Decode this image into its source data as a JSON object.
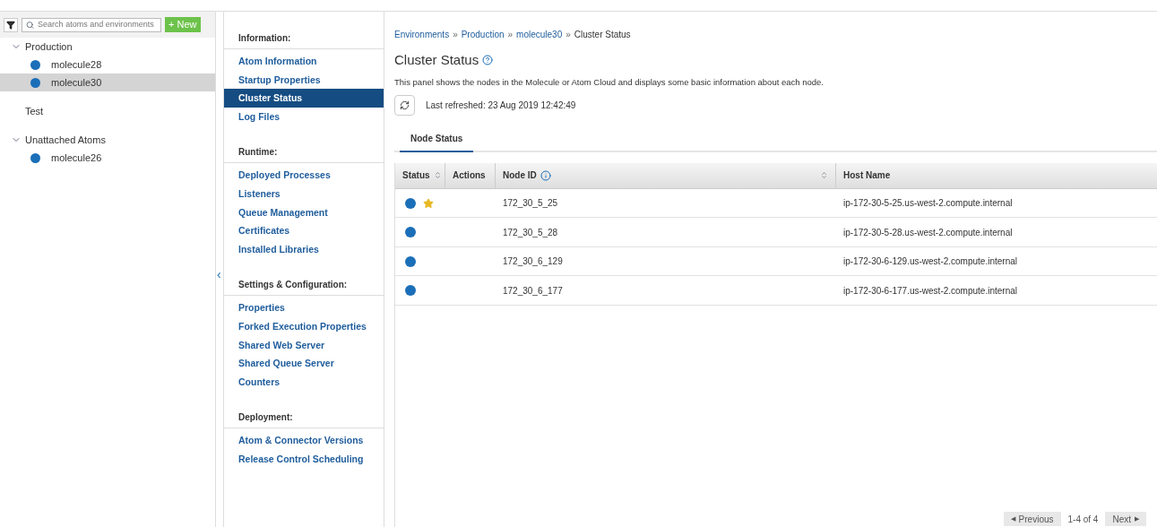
{
  "sidebar": {
    "search": {
      "placeholder": "Search atoms and environments"
    },
    "new_button": "+ New",
    "tree": [
      {
        "label": "Production",
        "expanded": true,
        "children": [
          {
            "label": "molecule28",
            "selected": false
          },
          {
            "label": "molecule30",
            "selected": true
          }
        ]
      },
      {
        "label": "Test"
      },
      {
        "label": "Unattached Atoms",
        "expanded": true,
        "children": [
          {
            "label": "molecule26",
            "selected": false
          }
        ]
      }
    ]
  },
  "nav": {
    "collapse_icon": "‹",
    "sections": [
      {
        "title": "Information:",
        "items": [
          {
            "label": "Atom Information",
            "selected": false
          },
          {
            "label": "Startup Properties",
            "selected": false
          },
          {
            "label": "Cluster Status",
            "selected": true
          },
          {
            "label": "Log Files",
            "selected": false
          }
        ]
      },
      {
        "title": "Runtime:",
        "items": [
          {
            "label": "Deployed Processes",
            "selected": false
          },
          {
            "label": "Listeners",
            "selected": false
          },
          {
            "label": "Queue Management",
            "selected": false
          },
          {
            "label": "Certificates",
            "selected": false
          },
          {
            "label": "Installed Libraries",
            "selected": false
          }
        ]
      },
      {
        "title": "Settings & Configuration:",
        "items": [
          {
            "label": "Properties",
            "selected": false
          },
          {
            "label": "Forked Execution Properties",
            "selected": false
          },
          {
            "label": "Shared Web Server",
            "selected": false
          },
          {
            "label": "Shared Queue Server",
            "selected": false
          },
          {
            "label": "Counters",
            "selected": false
          }
        ]
      },
      {
        "title": "Deployment:",
        "items": [
          {
            "label": "Atom & Connector Versions",
            "selected": false
          },
          {
            "label": "Release Control Scheduling",
            "selected": false
          }
        ]
      }
    ]
  },
  "breadcrumb": [
    {
      "label": "Environments",
      "link": true
    },
    {
      "label": "Production",
      "link": true
    },
    {
      "label": "molecule30",
      "link": true
    },
    {
      "label": "Cluster Status",
      "link": false
    }
  ],
  "breadcrumb_separator": "»",
  "title": "Cluster Status",
  "description": "This panel shows the nodes in the Molecule or Atom Cloud and displays some basic information about each node.",
  "last_refreshed": "Last refreshed: 23 Aug 2019 12:42:49",
  "tabs": [
    {
      "label": "Node Status",
      "selected": true
    }
  ],
  "table": {
    "columns": [
      {
        "label": "Status",
        "sortable": true,
        "info": false
      },
      {
        "label": "Actions",
        "sortable": false,
        "info": false
      },
      {
        "label": "Node ID",
        "sortable": true,
        "info": true
      },
      {
        "label": "Host Name",
        "sortable": false,
        "info": false
      }
    ],
    "rows": [
      {
        "leader": true,
        "node_id": "172_30_5_25",
        "host_name": "ip-172-30-5-25.us-west-2.compute.internal"
      },
      {
        "leader": false,
        "node_id": "172_30_5_28",
        "host_name": "ip-172-30-5-28.us-west-2.compute.internal"
      },
      {
        "leader": false,
        "node_id": "172_30_6_129",
        "host_name": "ip-172-30-6-129.us-west-2.compute.internal"
      },
      {
        "leader": false,
        "node_id": "172_30_6_177",
        "host_name": "ip-172-30-6-177.us-west-2.compute.internal"
      }
    ]
  },
  "pagination": {
    "previous_icon": "◀",
    "previous": "Previous",
    "range": "1-4 of 4",
    "next": "Next",
    "next_icon": "▶"
  }
}
